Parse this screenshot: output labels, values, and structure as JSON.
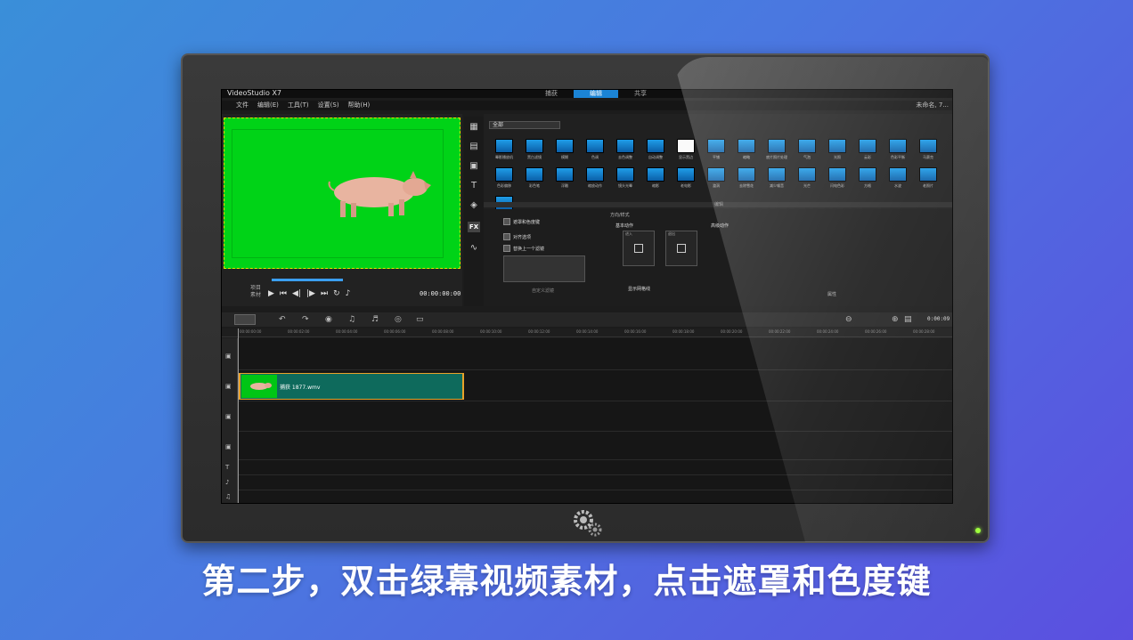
{
  "app": {
    "title": "VideoStudio X7",
    "project_name": "未命名, 7...",
    "step_tabs": [
      "捕获",
      "编辑",
      "共享"
    ],
    "active_tab_index": 1,
    "menu": [
      "文件",
      "编辑(E)",
      "工具(T)",
      "设置(S)",
      "帮助(H)"
    ]
  },
  "preview": {
    "mode_project": "项目",
    "mode_clip": "素材",
    "timecode": "00:00:00:00"
  },
  "library": {
    "filter": "全部",
    "effects": [
      "晕影播放机",
      "黑白滤镜",
      "模糊",
      "色调",
      "去色调整",
      "自动调整",
      "显示黑边",
      "平铺",
      "缩略",
      "底片照片处理",
      "气泡",
      "光照",
      "云彩",
      "色彩平衡",
      "马赛克",
      "色彩偏移",
      "彩色笔",
      "浮雕",
      "缩放动作",
      "镜头光晕",
      "缩影",
      "老电影",
      "漩涡",
      "去除雪花",
      "减少噪音",
      "光芒",
      "闪电色彩",
      "方格",
      "水波",
      "老照片",
      "FX 单色"
    ]
  },
  "options": {
    "tab_label": "编辑",
    "attr_tab_label": "属性",
    "mask_chroma": "遮罩和色度键",
    "alignment": "对齐选项",
    "replace_last": "替换上一个滤镜",
    "direction_style": "方向/样式",
    "basic_motion": "基本动作",
    "advanced_motion": "高级动作",
    "show_grid": "显示网格线",
    "customize_filter": "自定义滤镜",
    "enter_label": "进入",
    "exit_label": "退出"
  },
  "timeline": {
    "zoom_time": "0:00:09",
    "ruler": [
      "00:00:00:00",
      "00:00:02:00",
      "00:00:04:00",
      "00:00:06:00",
      "00:00:08:00",
      "00:00:10:00",
      "00:00:12:00",
      "00:00:14:00",
      "00:00:16:00",
      "00:00:18:00",
      "00:00:20:00",
      "00:00:22:00",
      "00:00:24:00",
      "00:00:26:00",
      "00:00:28:00"
    ],
    "clip_name": "捕获 1877.wmv"
  },
  "caption": "第二步，双击绿幕视频素材，点击遮罩和色度键",
  "colors": {
    "background_start": "#3a8fd9",
    "background_end": "#5b4fe0",
    "green_screen": "#00d317",
    "active_tab": "#1b84d6",
    "clip": "#0e6a5c",
    "clip_border": "#e8a22a"
  }
}
